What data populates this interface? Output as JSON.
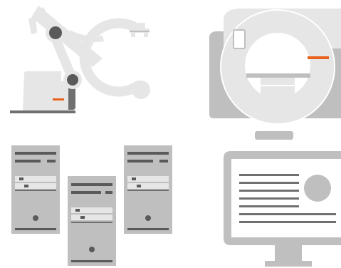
{
  "colors": {
    "light_gray": "#e6e6e6",
    "mid_gray": "#bfbfbf",
    "dark_gray": "#707070",
    "darker_gray": "#5a5a5a",
    "accent_orange": "#e8621c",
    "white": "#ffffff"
  },
  "illustrations": [
    {
      "id": "c-arm",
      "icon": "c-arm-xray-machine-icon"
    },
    {
      "id": "ct-scanner",
      "icon": "ct-mri-scanner-icon"
    },
    {
      "id": "servers",
      "icon": "server-towers-icon"
    },
    {
      "id": "monitor",
      "icon": "desktop-monitor-icon"
    }
  ]
}
